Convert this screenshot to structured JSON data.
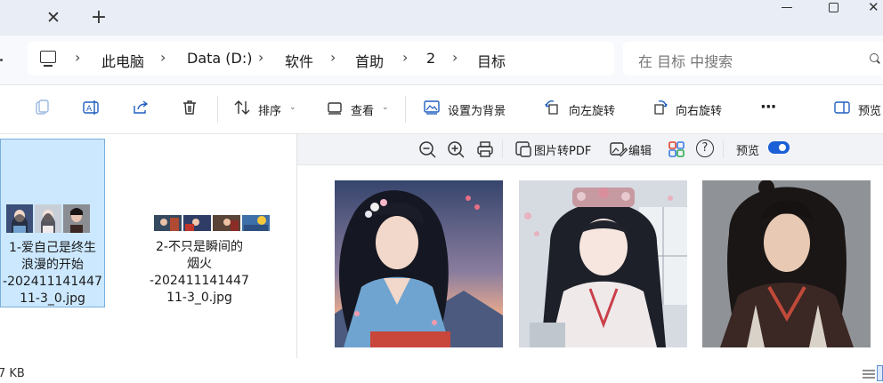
{
  "window": {
    "tab_close_glyph": "✕",
    "tab_new_glyph": "+",
    "close_glyph": "✕"
  },
  "breadcrumb": [
    "此电脑",
    "Data (D:)",
    "软件",
    "首助",
    "2",
    "目标"
  ],
  "breadcrumb_sep": "›",
  "search": {
    "placeholder": "在 目标 中搜索"
  },
  "toolbar": {
    "sort_label": "排序",
    "view_label": "查看",
    "set_bg_label": "设置为背景",
    "rotate_left_label": "向左旋转",
    "rotate_right_label": "向右旋转",
    "more_label": "···",
    "preview_label": "预览"
  },
  "files": [
    {
      "name_lines": [
        "1-爱自己是终生",
        "浪漫的开始",
        "-202411141447",
        "11-3_0.jpg"
      ],
      "selected": true
    },
    {
      "name_lines": [
        "2-不只是瞬间的",
        "烟火",
        "-202411141447",
        "11-3_0.jpg"
      ],
      "selected": false
    }
  ],
  "preview_toolbar": {
    "img2pdf_label": "图片转PDF",
    "edit_label": "编辑",
    "help_glyph": "?",
    "preview_label": "预览",
    "preview_toggle_on": true
  },
  "status": {
    "size_text": "7 KB"
  },
  "colors": {
    "accent": "#1a5fd6",
    "selection_bg": "#cce8ff",
    "titlebar_bg": "#e9eef6"
  }
}
